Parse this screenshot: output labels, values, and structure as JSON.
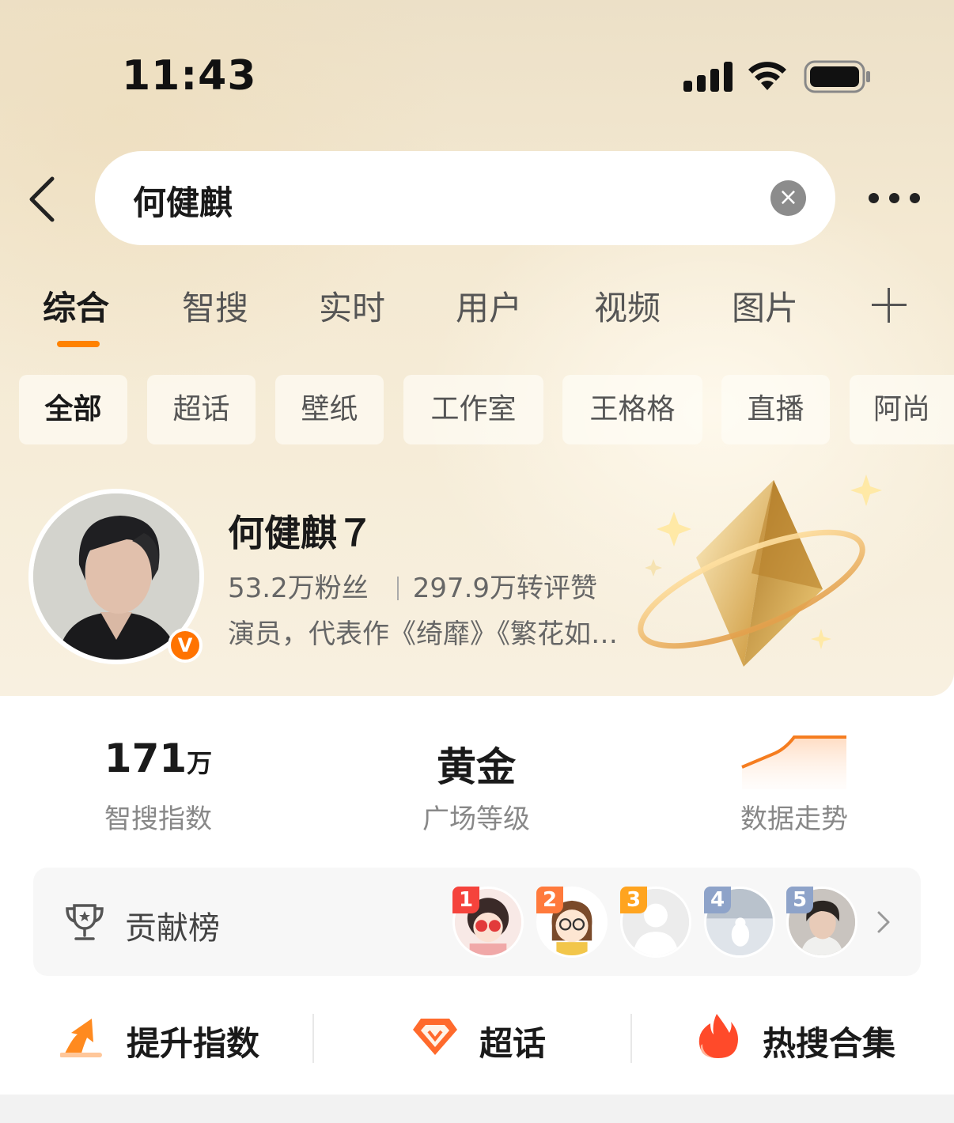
{
  "status_bar": {
    "time": "11:43"
  },
  "search": {
    "query": "何健麒",
    "clear_symbol": "×"
  },
  "tabs": [
    {
      "label": "综合",
      "active": true
    },
    {
      "label": "智搜"
    },
    {
      "label": "实时"
    },
    {
      "label": "用户"
    },
    {
      "label": "视频"
    },
    {
      "label": "图片"
    }
  ],
  "chips": [
    {
      "label": "全部",
      "active": true
    },
    {
      "label": "超话"
    },
    {
      "label": "壁纸"
    },
    {
      "label": "工作室"
    },
    {
      "label": "王格格"
    },
    {
      "label": "直播"
    },
    {
      "label": "阿尚"
    }
  ],
  "profile": {
    "name": "何健麒７",
    "followers": "53.2万粉丝",
    "interactions": "297.9万转评赞",
    "description": "演员，代表作《绮靡》《繁花如…",
    "verified_badge": "V"
  },
  "metrics": {
    "index_value": "171",
    "index_unit": "万",
    "index_label": "智搜指数",
    "level_value": "黄金",
    "level_label": "广场等级",
    "trend_label": "数据走势"
  },
  "rank": {
    "label": "贡献榜",
    "entries": [
      {
        "rank": "1",
        "badge_color": "#f5433c"
      },
      {
        "rank": "2",
        "badge_color": "#ff7a3c"
      },
      {
        "rank": "3",
        "badge_color": "#ffa41f"
      },
      {
        "rank": "4",
        "badge_color": "#8ea3c9"
      },
      {
        "rank": "5",
        "badge_color": "#8ea3c9"
      }
    ]
  },
  "actions": [
    {
      "label": "提升指数",
      "icon": "arrow-up-icon"
    },
    {
      "label": "超话",
      "icon": "diamond-icon"
    },
    {
      "label": "热搜合集",
      "icon": "flame-icon"
    }
  ],
  "colors": {
    "accent": "#ff8200",
    "verified": "#ff7300"
  }
}
